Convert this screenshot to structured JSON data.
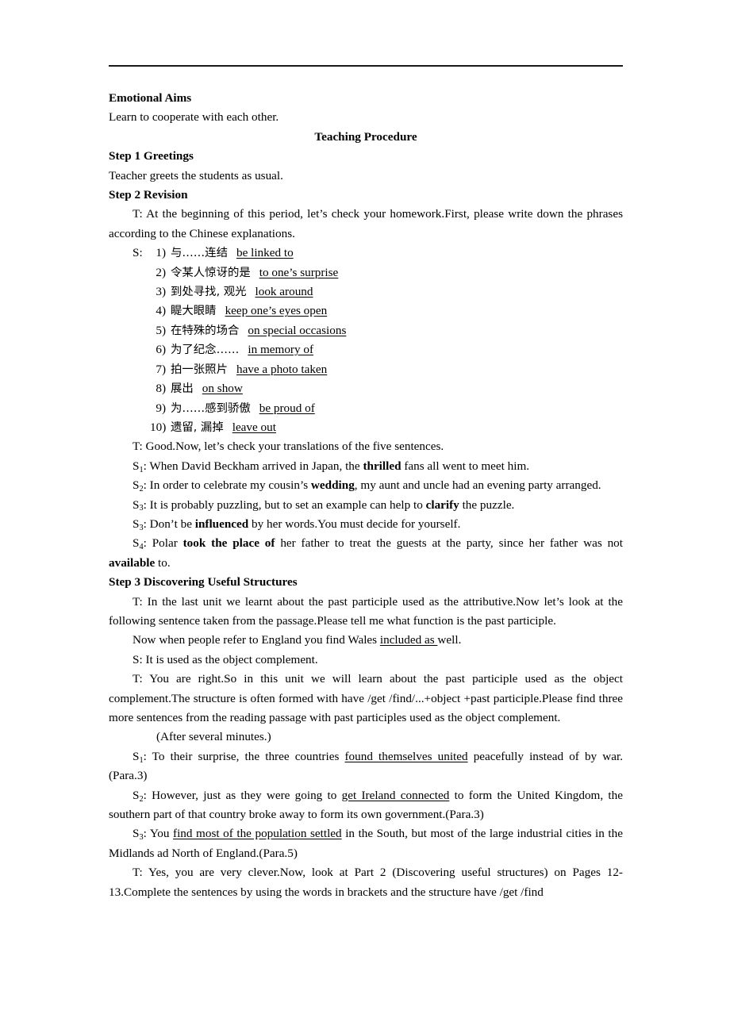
{
  "document": {
    "sections": {
      "emotional_aims_heading": "Emotional Aims",
      "emotional_aims_text": "Learn to cooperate with each other.",
      "teaching_procedure_heading": "Teaching Procedure",
      "step1_heading": "Step 1 Greetings",
      "step1_text": "Teacher greets the students as usual.",
      "step2_heading": "Step 2 Revision",
      "step2_intro": "T: At the beginning of this period, let’s check your homework.First, please write down the phrases according to the Chinese explanations.",
      "step3_heading": "Step 3 Discovering Useful Structures"
    },
    "phrase_list": [
      {
        "speaker": "S:",
        "num": "1)",
        "chinese": "与……连结",
        "answer": "be linked to"
      },
      {
        "speaker": "",
        "num": "2)",
        "chinese": "令某人惊讶的是",
        "answer": "to one’s surprise"
      },
      {
        "speaker": "",
        "num": "3)",
        "chinese": "到处寻找, 观光",
        "answer": "look around"
      },
      {
        "speaker": "",
        "num": "4)",
        "chinese": "睼大眼睛",
        "answer": "keep one’s eyes open"
      },
      {
        "speaker": "",
        "num": "5)",
        "chinese": "在特殊的场合",
        "answer": "on special occasions"
      },
      {
        "speaker": "",
        "num": "6)",
        "chinese": "为了纪念……",
        "answer": "in memory of"
      },
      {
        "speaker": "",
        "num": "7)",
        "chinese": "拍一张照片",
        "answer": "have a photo taken"
      },
      {
        "speaker": "",
        "num": "8)",
        "chinese": "展出",
        "answer": "on show"
      },
      {
        "speaker": "",
        "num": "9)",
        "chinese": "为……感到骄傲",
        "answer": "be proud of"
      },
      {
        "speaker": "",
        "num": "10)",
        "chinese": "遗留, 漏掉",
        "answer": "leave out"
      }
    ],
    "translation_check": {
      "prompt": "T: Good.Now, let’s check your translations of the five sentences.",
      "sentences": [
        {
          "label": "S",
          "sub": "1",
          "pre": ": When David Beckham arrived in Japan, the ",
          "bold": "thrilled",
          "post": " fans all went to meet him."
        },
        {
          "label": "S",
          "sub": "2",
          "pre": ": In order to celebrate my cousin’s ",
          "bold": "wedding",
          "post": ", my aunt and uncle had an evening party arranged."
        },
        {
          "label": "S",
          "sub": "3",
          "pre": ": It is probably puzzling, but to set an example can help to ",
          "bold": "clarify",
          "post": " the puzzle."
        },
        {
          "label": "S",
          "sub": "3",
          "pre": ": Don’t be ",
          "bold": "influenced",
          "post": " by her words.You must decide for yourself."
        },
        {
          "label": "S",
          "sub": "4",
          "pre": ": Polar ",
          "bold": "took the place of",
          "post": " her father to treat the guests at the party, since her father was not ",
          "bold2": "available",
          "post2": " to."
        }
      ]
    },
    "structures": {
      "teacher_intro": "T: In the last unit we learnt about the past participle used as the attributive.Now let’s look at the following sentence taken from the passage.Please tell me what function is the past participle.",
      "example_pre": "Now when people refer to England you find Wales ",
      "example_underline": "included as ",
      "example_post": "well.",
      "student_answer": "S: It is used as the object complement.",
      "teacher_explain": "T: You are right.So in this unit we will learn about the past participle used as the object complement.The structure is often formed with have /get /find/...+object +past participle.Please find three more sentences from the reading passage with past participles used as the object complement.",
      "stage_direction": "(After several minutes.)",
      "examples": [
        {
          "label": "S",
          "sub": "1",
          "pre": ": To their surprise, the three countries ",
          "underline": "found themselves united",
          "post": " peacefully instead of by war.(Para.3)"
        },
        {
          "label": "S",
          "sub": "2",
          "pre": ": However, just as they were going to ",
          "underline": "get Ireland connected",
          "post": " to form the United Kingdom, the southern part of that country broke away to form its own government.(Para.3)"
        },
        {
          "label": "S",
          "sub": "3",
          "pre": ": You ",
          "underline": "find most of the population settled",
          "post": " in the South, but most of the large industrial cities in the Midlands ad North of England.(Para.5)"
        }
      ],
      "closing": "T: Yes, you are very clever.Now, look at Part 2 (Discovering useful structures) on Pages 12-13.Complete the sentences by using the words in brackets and the structure have /get /find"
    }
  }
}
